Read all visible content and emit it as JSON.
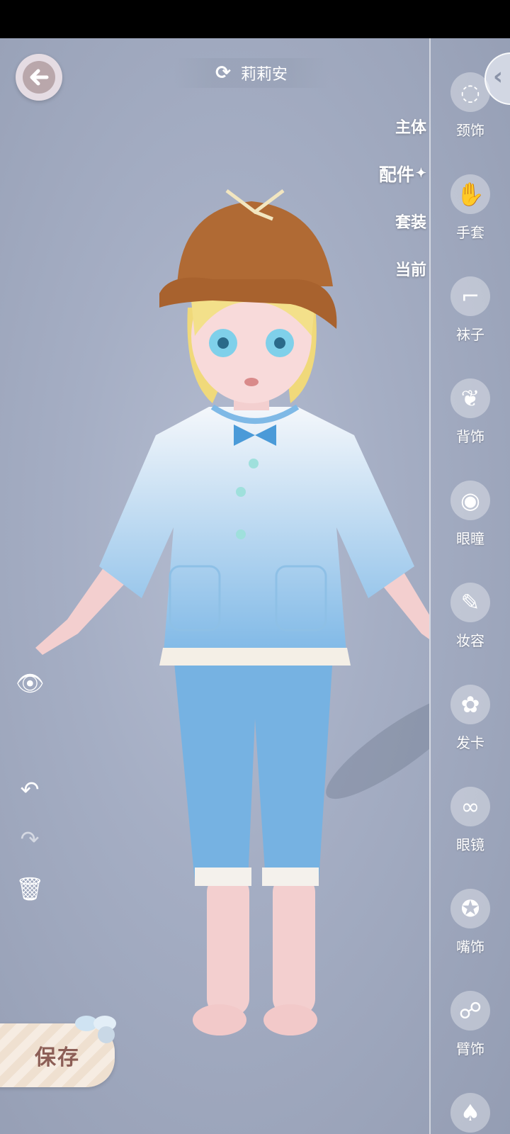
{
  "header": {
    "character_name": "莉莉安"
  },
  "category_tabs": [
    {
      "label": "主体",
      "active": false
    },
    {
      "label": "配件",
      "active": true
    },
    {
      "label": "套装",
      "active": false
    },
    {
      "label": "当前",
      "active": false
    }
  ],
  "sidebar": {
    "items": [
      {
        "label": "颈饰",
        "icon": "necklace-icon"
      },
      {
        "label": "手套",
        "icon": "glove-icon"
      },
      {
        "label": "袜子",
        "icon": "sock-icon"
      },
      {
        "label": "背饰",
        "icon": "wing-icon"
      },
      {
        "label": "眼瞳",
        "icon": "eye-icon"
      },
      {
        "label": "妆容",
        "icon": "makeup-brush-icon"
      },
      {
        "label": "发卡",
        "icon": "hairpin-icon"
      },
      {
        "label": "眼镜",
        "icon": "glasses-icon"
      },
      {
        "label": "嘴饰",
        "icon": "pacifier-icon"
      },
      {
        "label": "臂饰",
        "icon": "arm-accessory-icon"
      },
      {
        "label": "",
        "icon": "hat-icon"
      }
    ]
  },
  "save_button": {
    "label": "保存"
  },
  "colors": {
    "background": "#a5aec4",
    "save_text": "#8c5e56",
    "hat": "#b06a34",
    "outfit": "#7fb9e6"
  }
}
